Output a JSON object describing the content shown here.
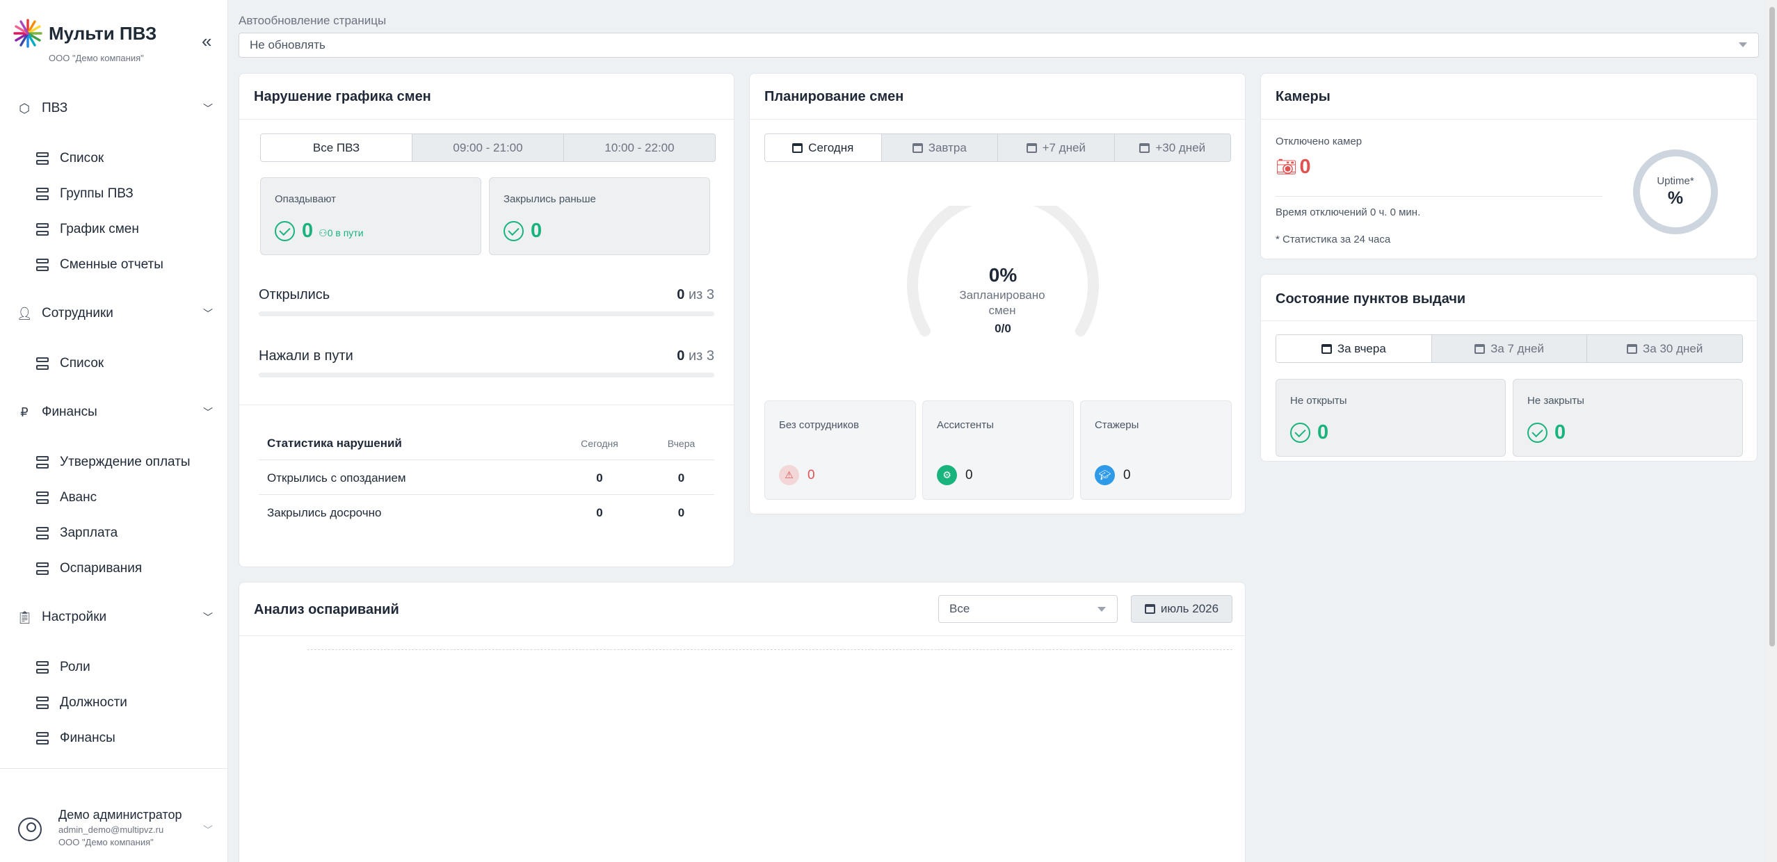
{
  "sidebar": {
    "brand_name": "Мульти ПВЗ",
    "brand_sub": "ООО \"Демо компания\"",
    "collapse": "«",
    "sections": [
      {
        "icon": "cube-icon",
        "label": "ПВЗ",
        "items": [
          "Список",
          "Группы ПВЗ",
          "График смен",
          "Сменные отчеты"
        ]
      },
      {
        "icon": "user-icon",
        "label": "Сотрудники",
        "items": [
          "Список"
        ]
      },
      {
        "icon": "ruble-icon",
        "label": "Финансы",
        "items": [
          "Утверждение оплаты",
          "Аванс",
          "Зарплата",
          "Оспаривания"
        ]
      },
      {
        "icon": "clipboard-icon",
        "label": "Настройки",
        "items": [
          "Роли",
          "Должности",
          "Финансы"
        ]
      }
    ],
    "user": {
      "name": "Демо администратор",
      "email": "admin_demo@multipvz.ru",
      "org": "ООО \"Демо компания\""
    }
  },
  "autoupdate": {
    "label": "Автообновление страницы",
    "value": "Не обновлять"
  },
  "violations": {
    "title": "Нарушение графика смен",
    "tabs": [
      "Все ПВЗ",
      "09:00 - 21:00",
      "10:00 - 22:00"
    ],
    "active_tab": 0,
    "late": {
      "label": "Опаздывают",
      "value": "0",
      "on_road": "0 в пути"
    },
    "closed_early": {
      "label": "Закрылись раньше",
      "value": "0"
    },
    "opened": {
      "label": "Открылись",
      "value": "0",
      "of": "из 3",
      "fraction": 0
    },
    "on_road": {
      "label": "Нажали в пути",
      "value": "0",
      "of": "из 3",
      "fraction": 0
    },
    "stats": {
      "header": "Статистика нарушений",
      "col_today": "Сегодня",
      "col_yesterday": "Вчера",
      "rows": [
        {
          "label": "Открылись с опозданием",
          "today": "0",
          "yesterday": "0"
        },
        {
          "label": "Закрылись досрочно",
          "today": "0",
          "yesterday": "0"
        }
      ]
    }
  },
  "planning": {
    "title": "Планирование смен",
    "tabs": [
      "Сегодня",
      "Завтра",
      "+7 дней",
      "+30 дней"
    ],
    "active_tab": 0,
    "gauge": {
      "percent": "0%",
      "label": "Запланировано смен",
      "fraction": "0/0",
      "value": 0
    },
    "boxes": [
      {
        "label": "Без сотрудников",
        "value": "0",
        "icon": "warning-icon",
        "color": "#e05252"
      },
      {
        "label": "Ассистенты",
        "value": "0",
        "icon": "assistant-icon",
        "color": "#19b37d"
      },
      {
        "label": "Стажеры",
        "value": "0",
        "icon": "graduation-cap-icon",
        "color": "#2f9be8"
      }
    ]
  },
  "cameras": {
    "title": "Камеры",
    "disconnected_label": "Отключено камер",
    "disconnected_value": "0",
    "downtime": "Время отключений 0 ч. 0 мин.",
    "note": "* Статистика за 24 часа",
    "uptime_label": "Uptime*",
    "uptime_value": "%"
  },
  "points": {
    "title": "Состояние пунктов выдачи",
    "tabs": [
      "За вчера",
      "За 7 дней",
      "За 30 дней"
    ],
    "active_tab": 0,
    "not_opened": {
      "label": "Не открыты",
      "value": "0"
    },
    "not_closed": {
      "label": "Не закрыты",
      "value": "0"
    }
  },
  "disputes": {
    "title": "Анализ оспариваний",
    "filter": "Все",
    "date": "июль 2026"
  },
  "colors": {
    "accent_green": "#19b37d",
    "danger": "#e05252",
    "info": "#2f9be8"
  }
}
